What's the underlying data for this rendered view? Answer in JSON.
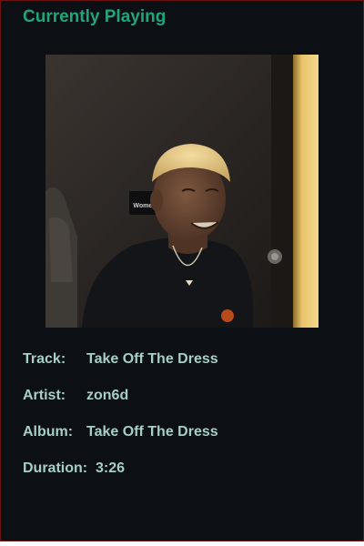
{
  "header": {
    "title": "Currently Playing"
  },
  "album_art": {
    "signage_text": "Women",
    "colors": {
      "wall": "#2a2624",
      "shirt": "#141518",
      "skin": "#6b4a36",
      "hair": "#e7c98a",
      "door_light": "#e8c46a"
    }
  },
  "track_info": {
    "track": {
      "label": "Track:",
      "value": "Take Off The Dress"
    },
    "artist": {
      "label": "Artist:",
      "value": "zon6d"
    },
    "album": {
      "label": "Album:",
      "value": "Take Off The Dress"
    },
    "duration": {
      "label": "Duration:",
      "value": "3:26"
    }
  },
  "colors": {
    "background": "#0c0f14",
    "title": "#1ea57a",
    "text": "#a6cfc7",
    "border": "#6b1212"
  }
}
